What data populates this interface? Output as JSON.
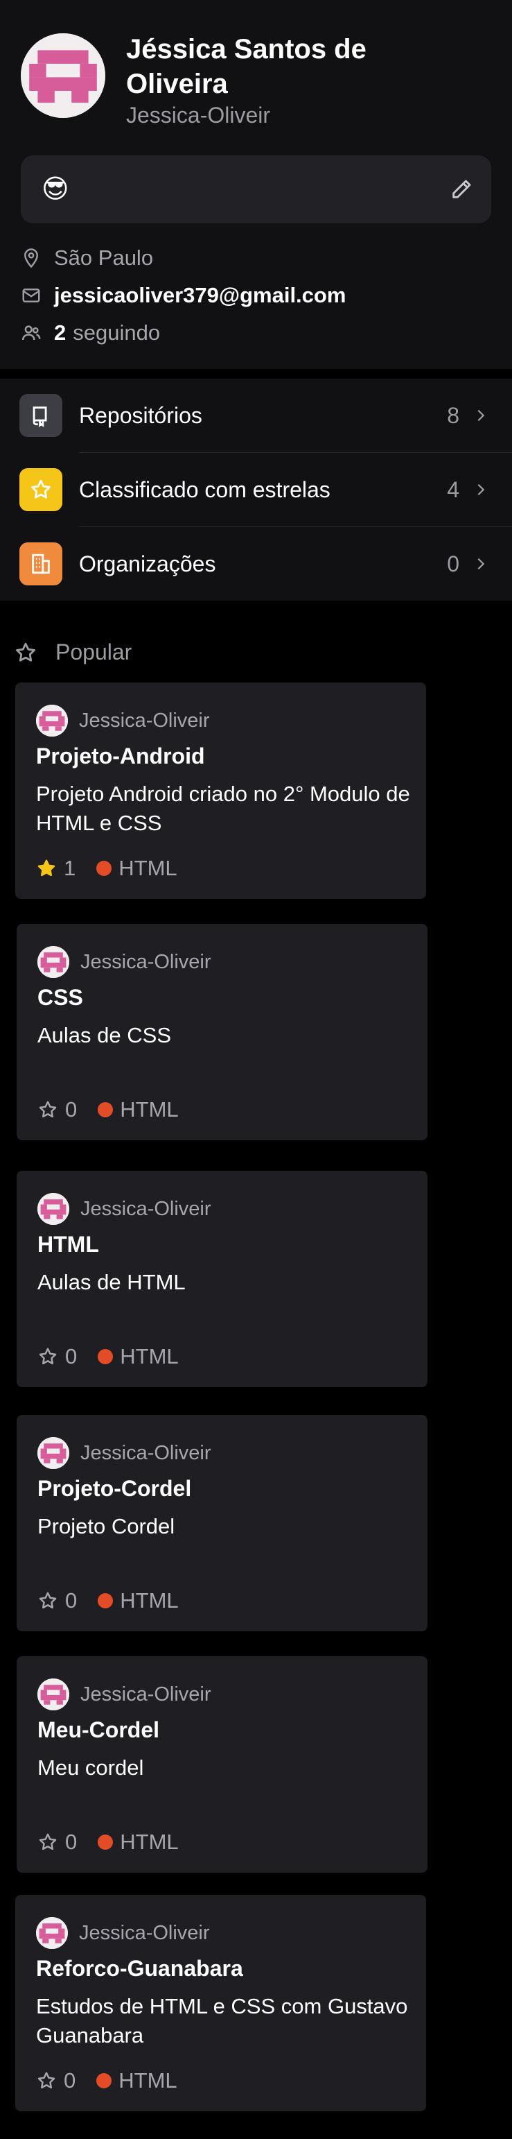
{
  "profile": {
    "name": "Jéssica Santos de Oliveira",
    "login": "Jessica-Oliveir",
    "status_emoji": "😎",
    "location": "São Paulo",
    "email": "jessicaoliver379@gmail.com",
    "following_count": "2",
    "following_label": "seguindo"
  },
  "menu": [
    {
      "label": "Repositórios",
      "count": "8",
      "icon": "repo-icon",
      "color": "#3d3d44"
    },
    {
      "label": "Classificado com estrelas",
      "count": "4",
      "icon": "star-icon",
      "color": "#f5c518"
    },
    {
      "label": "Organizações",
      "count": "0",
      "icon": "organization-icon",
      "color": "#f08a3c"
    }
  ],
  "popular": {
    "heading": "Popular",
    "cards": [
      {
        "owner": "Jessica-Oliveir",
        "title": "Projeto-Android",
        "description": "Projeto Android criado no 2° Modulo de HTML e CSS",
        "stars": "1",
        "starred": true,
        "language": "HTML",
        "language_color": "#e34c26"
      },
      {
        "owner": "Jessica-Oliveir",
        "title": "CSS",
        "description": "Aulas de CSS",
        "stars": "0",
        "starred": false,
        "language": "HTML",
        "language_color": "#e34c26"
      },
      {
        "owner": "Jessica-Oliveir",
        "title": "HTML",
        "description": "Aulas de HTML",
        "stars": "0",
        "starred": false,
        "language": "HTML",
        "language_color": "#e34c26"
      },
      {
        "owner": "Jessica-Oliveir",
        "title": "Projeto-Cordel",
        "description": "Projeto Cordel",
        "stars": "0",
        "starred": false,
        "language": "HTML",
        "language_color": "#e34c26"
      },
      {
        "owner": "Jessica-Oliveir",
        "title": "Meu-Cordel",
        "description": "Meu cordel",
        "stars": "0",
        "starred": false,
        "language": "HTML",
        "language_color": "#e34c26"
      },
      {
        "owner": "Jessica-Oliveir",
        "title": "Reforco-Guanabara",
        "description": "Estudos de HTML e CSS com Gustavo Guanabara",
        "stars": "0",
        "starred": false,
        "language": "HTML",
        "language_color": "#e34c26"
      }
    ]
  }
}
